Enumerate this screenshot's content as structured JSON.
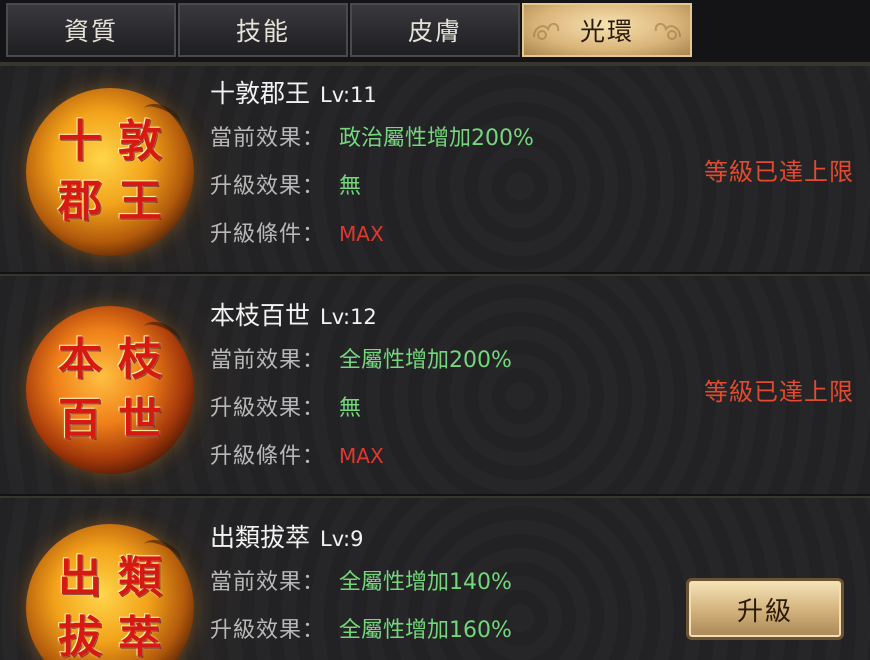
{
  "tabs": [
    {
      "label": "資質",
      "active": false
    },
    {
      "label": "技能",
      "active": false
    },
    {
      "label": "皮膚",
      "active": false
    },
    {
      "label": "光環",
      "active": true
    }
  ],
  "labels": {
    "current_effect": "當前效果：",
    "upgrade_effect": "升級效果：",
    "upgrade_condition": "升級條件："
  },
  "auras": [
    {
      "name": "十敦郡王",
      "level": "Lv:11",
      "medal_chars": [
        "十",
        "敦",
        "郡",
        "王"
      ],
      "current_effect": "政治屬性增加200%",
      "upgrade_effect": "無",
      "upgrade_condition": "MAX",
      "status": "等級已達上限"
    },
    {
      "name": "本枝百世",
      "level": "Lv:12",
      "medal_chars": [
        "本",
        "枝",
        "百",
        "世"
      ],
      "current_effect": "全屬性增加200%",
      "upgrade_effect": "無",
      "upgrade_condition": "MAX",
      "status": "等級已達上限"
    },
    {
      "name": "出類拔萃",
      "level": "Lv:9",
      "medal_chars": [
        "出",
        "類",
        "拔",
        "萃"
      ],
      "current_effect": "全屬性增加140%",
      "upgrade_effect": "全屬性增加160%",
      "upgrade_button": "升級"
    }
  ],
  "colors": {
    "effect_green": "#74d67d",
    "max_red": "#e0382c",
    "status_red": "#e34a2f",
    "tab_active": "#d9b479"
  }
}
